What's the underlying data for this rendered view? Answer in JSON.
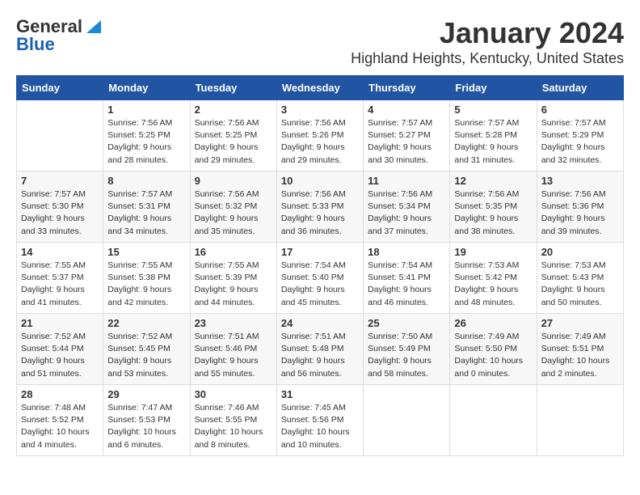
{
  "logo": {
    "text_general": "General",
    "text_blue": "Blue"
  },
  "title": {
    "month_year": "January 2024",
    "location": "Highland Heights, Kentucky, United States"
  },
  "days_of_week": [
    "Sunday",
    "Monday",
    "Tuesday",
    "Wednesday",
    "Thursday",
    "Friday",
    "Saturday"
  ],
  "weeks": [
    [
      {
        "day": "",
        "sunrise": "",
        "sunset": "",
        "daylight": ""
      },
      {
        "day": "1",
        "sunrise": "Sunrise: 7:56 AM",
        "sunset": "Sunset: 5:25 PM",
        "daylight": "Daylight: 9 hours and 28 minutes."
      },
      {
        "day": "2",
        "sunrise": "Sunrise: 7:56 AM",
        "sunset": "Sunset: 5:25 PM",
        "daylight": "Daylight: 9 hours and 29 minutes."
      },
      {
        "day": "3",
        "sunrise": "Sunrise: 7:56 AM",
        "sunset": "Sunset: 5:26 PM",
        "daylight": "Daylight: 9 hours and 29 minutes."
      },
      {
        "day": "4",
        "sunrise": "Sunrise: 7:57 AM",
        "sunset": "Sunset: 5:27 PM",
        "daylight": "Daylight: 9 hours and 30 minutes."
      },
      {
        "day": "5",
        "sunrise": "Sunrise: 7:57 AM",
        "sunset": "Sunset: 5:28 PM",
        "daylight": "Daylight: 9 hours and 31 minutes."
      },
      {
        "day": "6",
        "sunrise": "Sunrise: 7:57 AM",
        "sunset": "Sunset: 5:29 PM",
        "daylight": "Daylight: 9 hours and 32 minutes."
      }
    ],
    [
      {
        "day": "7",
        "sunrise": "Sunrise: 7:57 AM",
        "sunset": "Sunset: 5:30 PM",
        "daylight": "Daylight: 9 hours and 33 minutes."
      },
      {
        "day": "8",
        "sunrise": "Sunrise: 7:57 AM",
        "sunset": "Sunset: 5:31 PM",
        "daylight": "Daylight: 9 hours and 34 minutes."
      },
      {
        "day": "9",
        "sunrise": "Sunrise: 7:56 AM",
        "sunset": "Sunset: 5:32 PM",
        "daylight": "Daylight: 9 hours and 35 minutes."
      },
      {
        "day": "10",
        "sunrise": "Sunrise: 7:56 AM",
        "sunset": "Sunset: 5:33 PM",
        "daylight": "Daylight: 9 hours and 36 minutes."
      },
      {
        "day": "11",
        "sunrise": "Sunrise: 7:56 AM",
        "sunset": "Sunset: 5:34 PM",
        "daylight": "Daylight: 9 hours and 37 minutes."
      },
      {
        "day": "12",
        "sunrise": "Sunrise: 7:56 AM",
        "sunset": "Sunset: 5:35 PM",
        "daylight": "Daylight: 9 hours and 38 minutes."
      },
      {
        "day": "13",
        "sunrise": "Sunrise: 7:56 AM",
        "sunset": "Sunset: 5:36 PM",
        "daylight": "Daylight: 9 hours and 39 minutes."
      }
    ],
    [
      {
        "day": "14",
        "sunrise": "Sunrise: 7:55 AM",
        "sunset": "Sunset: 5:37 PM",
        "daylight": "Daylight: 9 hours and 41 minutes."
      },
      {
        "day": "15",
        "sunrise": "Sunrise: 7:55 AM",
        "sunset": "Sunset: 5:38 PM",
        "daylight": "Daylight: 9 hours and 42 minutes."
      },
      {
        "day": "16",
        "sunrise": "Sunrise: 7:55 AM",
        "sunset": "Sunset: 5:39 PM",
        "daylight": "Daylight: 9 hours and 44 minutes."
      },
      {
        "day": "17",
        "sunrise": "Sunrise: 7:54 AM",
        "sunset": "Sunset: 5:40 PM",
        "daylight": "Daylight: 9 hours and 45 minutes."
      },
      {
        "day": "18",
        "sunrise": "Sunrise: 7:54 AM",
        "sunset": "Sunset: 5:41 PM",
        "daylight": "Daylight: 9 hours and 46 minutes."
      },
      {
        "day": "19",
        "sunrise": "Sunrise: 7:53 AM",
        "sunset": "Sunset: 5:42 PM",
        "daylight": "Daylight: 9 hours and 48 minutes."
      },
      {
        "day": "20",
        "sunrise": "Sunrise: 7:53 AM",
        "sunset": "Sunset: 5:43 PM",
        "daylight": "Daylight: 9 hours and 50 minutes."
      }
    ],
    [
      {
        "day": "21",
        "sunrise": "Sunrise: 7:52 AM",
        "sunset": "Sunset: 5:44 PM",
        "daylight": "Daylight: 9 hours and 51 minutes."
      },
      {
        "day": "22",
        "sunrise": "Sunrise: 7:52 AM",
        "sunset": "Sunset: 5:45 PM",
        "daylight": "Daylight: 9 hours and 53 minutes."
      },
      {
        "day": "23",
        "sunrise": "Sunrise: 7:51 AM",
        "sunset": "Sunset: 5:46 PM",
        "daylight": "Daylight: 9 hours and 55 minutes."
      },
      {
        "day": "24",
        "sunrise": "Sunrise: 7:51 AM",
        "sunset": "Sunset: 5:48 PM",
        "daylight": "Daylight: 9 hours and 56 minutes."
      },
      {
        "day": "25",
        "sunrise": "Sunrise: 7:50 AM",
        "sunset": "Sunset: 5:49 PM",
        "daylight": "Daylight: 9 hours and 58 minutes."
      },
      {
        "day": "26",
        "sunrise": "Sunrise: 7:49 AM",
        "sunset": "Sunset: 5:50 PM",
        "daylight": "Daylight: 10 hours and 0 minutes."
      },
      {
        "day": "27",
        "sunrise": "Sunrise: 7:49 AM",
        "sunset": "Sunset: 5:51 PM",
        "daylight": "Daylight: 10 hours and 2 minutes."
      }
    ],
    [
      {
        "day": "28",
        "sunrise": "Sunrise: 7:48 AM",
        "sunset": "Sunset: 5:52 PM",
        "daylight": "Daylight: 10 hours and 4 minutes."
      },
      {
        "day": "29",
        "sunrise": "Sunrise: 7:47 AM",
        "sunset": "Sunset: 5:53 PM",
        "daylight": "Daylight: 10 hours and 6 minutes."
      },
      {
        "day": "30",
        "sunrise": "Sunrise: 7:46 AM",
        "sunset": "Sunset: 5:55 PM",
        "daylight": "Daylight: 10 hours and 8 minutes."
      },
      {
        "day": "31",
        "sunrise": "Sunrise: 7:45 AM",
        "sunset": "Sunset: 5:56 PM",
        "daylight": "Daylight: 10 hours and 10 minutes."
      },
      {
        "day": "",
        "sunrise": "",
        "sunset": "",
        "daylight": ""
      },
      {
        "day": "",
        "sunrise": "",
        "sunset": "",
        "daylight": ""
      },
      {
        "day": "",
        "sunrise": "",
        "sunset": "",
        "daylight": ""
      }
    ]
  ]
}
